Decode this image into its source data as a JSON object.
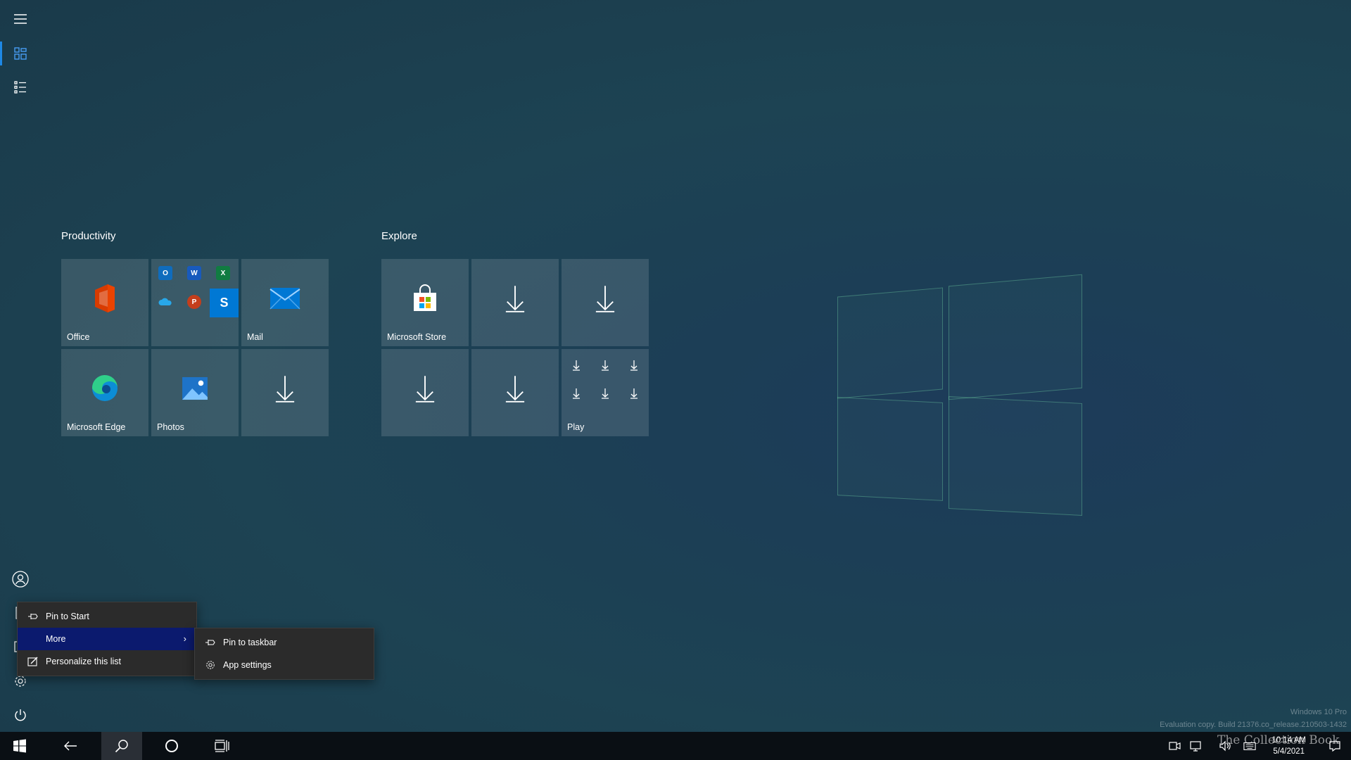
{
  "rail": {
    "items": [
      {
        "name": "hamburger-menu-button"
      },
      {
        "name": "pinned-tiles-button"
      },
      {
        "name": "all-apps-list-button"
      },
      {
        "name": "user-account-button"
      },
      {
        "name": "documents-button"
      },
      {
        "name": "pictures-button"
      },
      {
        "name": "settings-button"
      },
      {
        "name": "power-button"
      }
    ]
  },
  "groups": [
    {
      "title": "Productivity",
      "tiles": [
        {
          "label": "Office",
          "icon": "office-icon"
        },
        {
          "label": "",
          "icon": "office-apps-folder-icon"
        },
        {
          "label": "Mail",
          "icon": "mail-icon"
        },
        {
          "label": "Microsoft Edge",
          "icon": "edge-icon"
        },
        {
          "label": "Photos",
          "icon": "photos-icon"
        },
        {
          "label": "",
          "icon": "download-icon"
        }
      ]
    },
    {
      "title": "Explore",
      "tiles": [
        {
          "label": "Microsoft Store",
          "icon": "store-icon"
        },
        {
          "label": "",
          "icon": "download-icon"
        },
        {
          "label": "",
          "icon": "download-icon"
        },
        {
          "label": "",
          "icon": "download-icon"
        },
        {
          "label": "",
          "icon": "download-icon"
        },
        {
          "label": "Play",
          "icon": "play-folder-icon"
        }
      ]
    }
  ],
  "context_menu": {
    "items": [
      {
        "label": "Pin to Start",
        "icon": "pin-icon"
      },
      {
        "label": "More",
        "icon": "",
        "highlighted": true
      },
      {
        "label": "Personalize this list",
        "icon": "personalize-icon"
      }
    ]
  },
  "submenu": {
    "items": [
      {
        "label": "Pin to taskbar",
        "icon": "pin-icon"
      },
      {
        "label": "App settings",
        "icon": "gear-icon"
      }
    ]
  },
  "taskbar": {
    "buttons": [
      "start-button",
      "back-button",
      "search-button",
      "cortana-button",
      "task-view-button"
    ],
    "clock": {
      "time": "10:14 AM",
      "date": "5/4/2021"
    }
  },
  "watermark": {
    "line1": "Windows 10 Pro",
    "line2": "Evaluation copy. Build 21376.co_release.210503-1432",
    "brand": "The Collection Book"
  },
  "colors": {
    "accent": "#1e88e5",
    "menu_highlight": "#0b1a6e",
    "taskbar": "#0a0f14"
  }
}
